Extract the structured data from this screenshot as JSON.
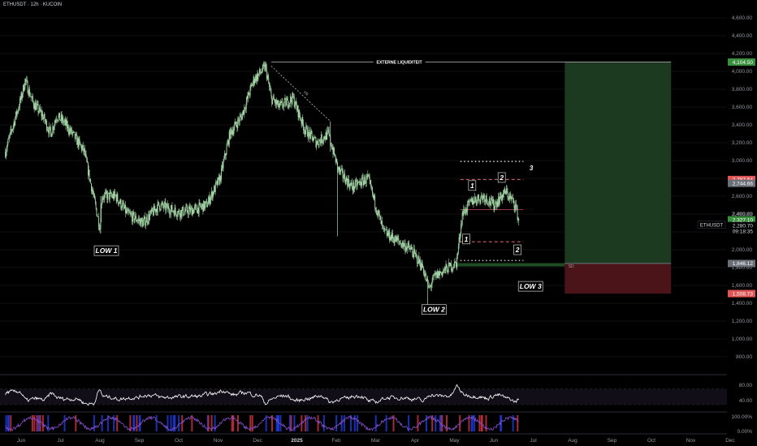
{
  "header": {
    "symbol_line": "ETHUSDT · 12h · KUCOIN"
  },
  "colors": {
    "background": "#000000",
    "candle": "#a5d6a7",
    "target_zone": "#1b3a1f",
    "stop_zone": "#4a1418",
    "accent_green": "#3a8f3e",
    "accent_red": "#e05555",
    "rsi_line": "#ffffff"
  },
  "chart_data": {
    "type": "candlestick",
    "symbol": "ETHUSDT",
    "interval": "12h",
    "exchange": "KUCOIN",
    "y_axis": {
      "range": [
        700,
        4750
      ],
      "ticks": [
        "4,600.00",
        "4,400.00",
        "4,200.00",
        "4,000.00",
        "3,800.00",
        "3,600.00",
        "3,400.00",
        "3,200.00",
        "3,000.00",
        "2,800.00",
        "2,600.00",
        "2,400.00",
        "2,200.00",
        "2,000.00",
        "1,800.00",
        "1,600.00",
        "1,400.00",
        "1,200.00",
        "1,000.00",
        "800.00"
      ],
      "tick_values": [
        4600,
        4400,
        4200,
        4000,
        3800,
        3600,
        3400,
        3200,
        3000,
        2800,
        2600,
        2400,
        2200,
        2000,
        1800,
        1600,
        1400,
        1200,
        1000,
        800
      ]
    },
    "x_axis": {
      "labels": [
        "Jun",
        "Jul",
        "Aug",
        "Sep",
        "Oct",
        "Nov",
        "Dec",
        "2025",
        "Feb",
        "Mar",
        "Apr",
        "May",
        "Jun",
        "Jul",
        "Aug",
        "Sep",
        "Oct",
        "Nov",
        "Dec"
      ],
      "label_months": [
        0,
        1,
        2,
        3,
        4,
        5,
        6,
        7,
        8,
        9,
        10,
        11,
        12,
        13,
        14,
        15,
        16,
        17,
        18
      ]
    },
    "price_path": [
      [
        -0.4,
        3100
      ],
      [
        0,
        3700
      ],
      [
        0.1,
        3900
      ],
      [
        0.3,
        3650
      ],
      [
        0.55,
        3500
      ],
      [
        0.75,
        3300
      ],
      [
        0.9,
        3500
      ],
      [
        1.05,
        3450
      ],
      [
        1.3,
        3300
      ],
      [
        1.6,
        3100
      ],
      [
        2.0,
        2250
      ],
      [
        2.05,
        2600
      ],
      [
        2.4,
        2600
      ],
      [
        2.7,
        2400
      ],
      [
        3.1,
        2300
      ],
      [
        3.5,
        2500
      ],
      [
        4.0,
        2420
      ],
      [
        4.4,
        2450
      ],
      [
        4.7,
        2500
      ],
      [
        5.05,
        2800
      ],
      [
        5.3,
        3300
      ],
      [
        5.6,
        3500
      ],
      [
        5.9,
        3900
      ],
      [
        6.2,
        4050
      ],
      [
        6.35,
        3700
      ],
      [
        6.55,
        3600
      ],
      [
        6.9,
        3700
      ],
      [
        7.2,
        3350
      ],
      [
        7.5,
        3200
      ],
      [
        7.8,
        3300
      ],
      [
        8.05,
        2900
      ],
      [
        8.4,
        2700
      ],
      [
        8.8,
        2800
      ],
      [
        9.2,
        2200
      ],
      [
        9.55,
        2100
      ],
      [
        9.9,
        2000
      ],
      [
        10.2,
        1800
      ],
      [
        10.35,
        1560
      ],
      [
        10.5,
        1700
      ],
      [
        10.85,
        1800
      ],
      [
        11.05,
        1850
      ],
      [
        11.2,
        2400
      ],
      [
        11.45,
        2550
      ],
      [
        11.75,
        2600
      ],
      [
        12.0,
        2500
      ],
      [
        12.3,
        2650
      ],
      [
        12.55,
        2500
      ],
      [
        12.65,
        2280
      ]
    ],
    "wicks": [
      [
        2.02,
        2180,
        2600
      ],
      [
        8.03,
        2150,
        2900
      ],
      [
        10.32,
        1390,
        1700
      ]
    ],
    "annotations": {
      "externe_liquiditeit": {
        "label": "EXTERNE LIQUIDITEIT",
        "price": 4104.5
      },
      "trendline_label": "FR",
      "lows": [
        {
          "label": "LOW 1",
          "month": 2.0,
          "price": 1990
        },
        {
          "label": "LOW 2",
          "month": 10.4,
          "price": 1330
        },
        {
          "label": "LOW 3",
          "month": 12.85,
          "price": 1590
        }
      ],
      "waves": [
        "1",
        "2",
        "3",
        "1",
        "2"
      ],
      "sd_label": "SD",
      "dotted_levels": [
        2990,
        1880
      ],
      "dashed_levels": [
        2787.64,
        2090
      ],
      "solid_level": 2450
    },
    "position": {
      "target": 4104.5,
      "entry": 1846.12,
      "stop": 1508.73
    },
    "price_labels": {
      "target": "4,104.50",
      "stop_upper": "2,787.64",
      "level_upper": "2,744.66",
      "level_green": "2,327.10",
      "hidden_2400": "2,400.00",
      "current_price": "2,280.70",
      "countdown": "09:18:35",
      "entry": "1,846.12",
      "stop": "1,508.73",
      "symbol_tag": "ETHUSDT"
    },
    "rsi": {
      "range": [
        15,
        95
      ],
      "ticks": [
        "80.00",
        "40.00"
      ],
      "tick_values": [
        80,
        40
      ],
      "levels": [
        70,
        50,
        30
      ]
    },
    "osc": {
      "ticks": [
        "100.00%",
        "0.00%"
      ]
    }
  }
}
